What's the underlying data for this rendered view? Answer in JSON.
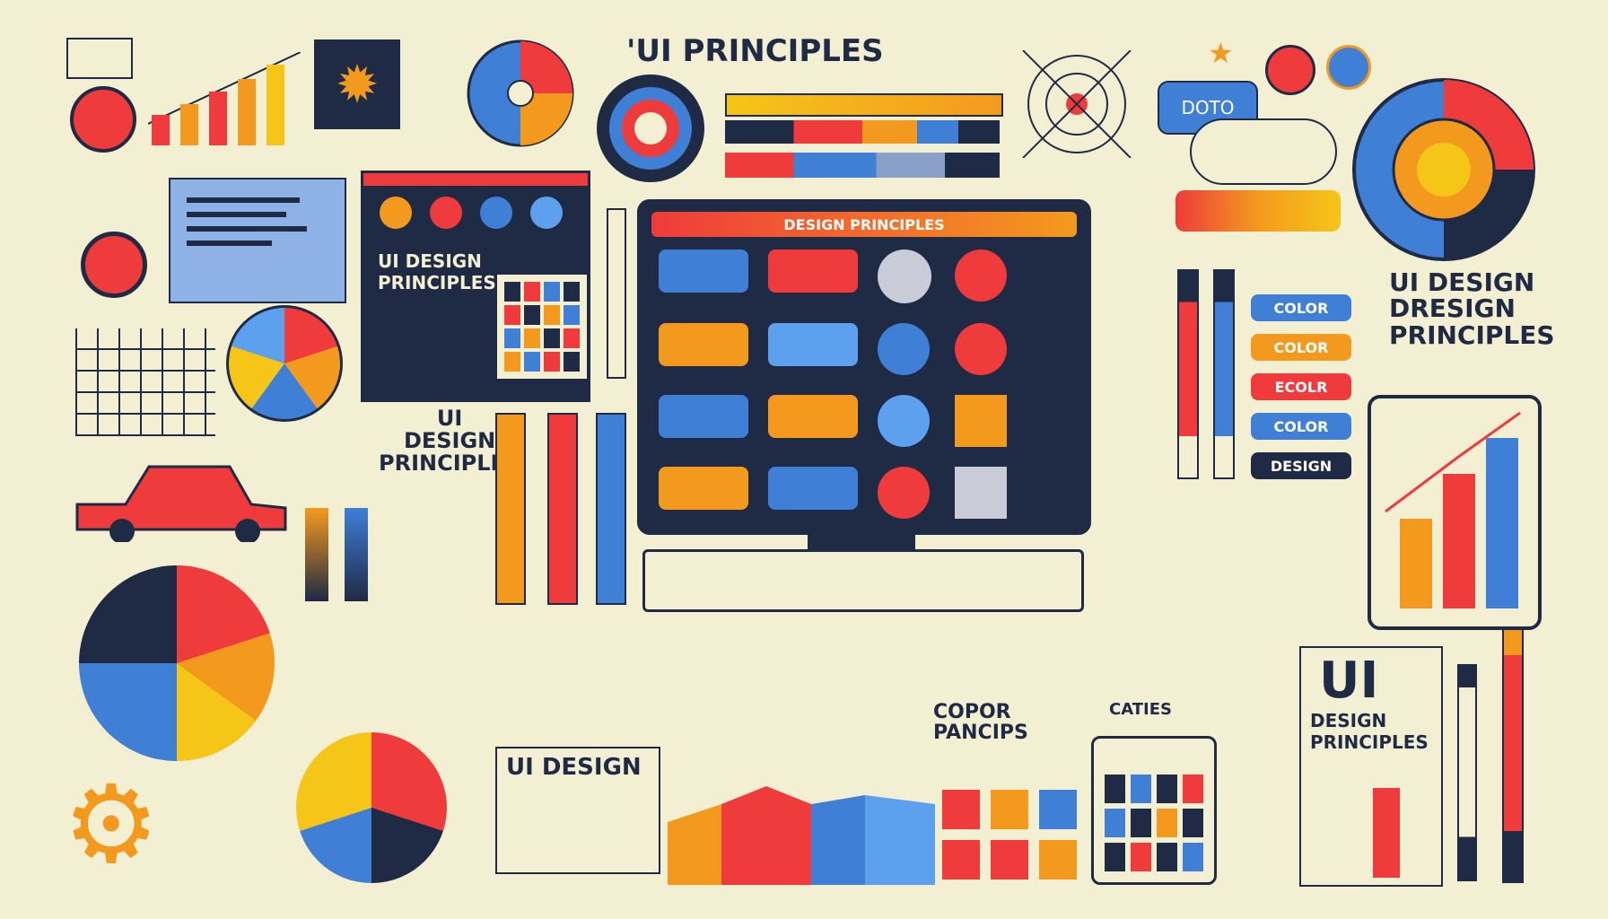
{
  "header": {
    "title": "'UI PRINCIPLES"
  },
  "monitor": {
    "title_bar": "DESIGN PRINCIPLES"
  },
  "speech_bubble": {
    "text": "DOTO"
  },
  "cards": {
    "left_window_title": "UI DESIGN\nPRINCIPLES",
    "mid_left": "UI\nDESIGN\nPRINCIPLES",
    "right_top": "UI DESIGN\nDRESIGN\nPRINCIPLES",
    "bottom_middle": "UI DESIGN",
    "bottom_right_big": "UI",
    "bottom_right_sub": "DESIGN\nPRINCIPLES",
    "color_note": "COPOR\nPANCIPS",
    "caption": "CATIES"
  },
  "tags": [
    {
      "label": "COLOR",
      "bg": "#3f7fd6",
      "fg": "#ffffff"
    },
    {
      "label": "COLOR",
      "bg": "#f39a1e",
      "fg": "#ffffff"
    },
    {
      "label": "ECOLR",
      "bg": "#ef3b3b",
      "fg": "#ffffff"
    },
    {
      "label": "COLOR",
      "bg": "#3f7fd6",
      "fg": "#ffffff"
    },
    {
      "label": "DESIGN",
      "bg": "#1f2a44",
      "fg": "#ffffff"
    }
  ],
  "colors": {
    "background": "#f3efd3",
    "navy": "#1f2a44",
    "red": "#ef3b3b",
    "orange": "#f39a1e",
    "blue": "#3f7fd6",
    "yellow": "#f5c518"
  }
}
